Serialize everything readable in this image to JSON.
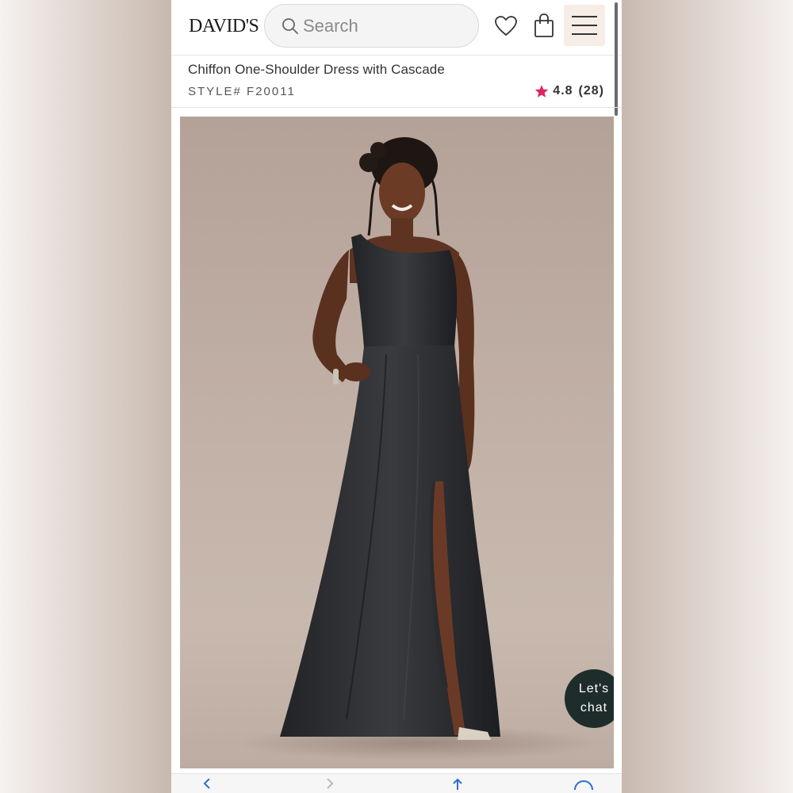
{
  "header": {
    "logo": "DAVID'S",
    "search_placeholder": "Search",
    "icons": [
      "heart-icon",
      "bag-icon",
      "hamburger-menu-icon"
    ]
  },
  "product": {
    "title": "Chiffon One-Shoulder Dress with Cascade",
    "style": "STYLE# F20011",
    "rating": "4.8",
    "review_count": "(28)",
    "rating_color": "#e0245e"
  },
  "chat": {
    "line1": "Let's",
    "line2": "chat",
    "color": "#1e2d2b"
  }
}
